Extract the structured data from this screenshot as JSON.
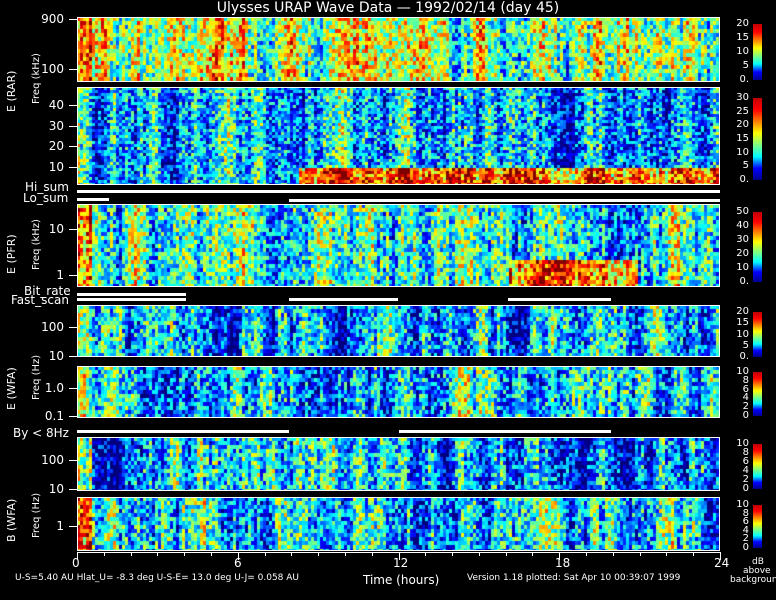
{
  "title": "Ulysses URAP Wave Data — 1992/02/14  (day 45)",
  "chart_data": {
    "type": "heatmap",
    "title": "Ulysses URAP Wave Data — 1992/02/14  (day 45)",
    "xlabel": "Time (hours)",
    "xlim": [
      0,
      24
    ],
    "xticks": [
      "0",
      "6",
      "12",
      "18",
      "24"
    ],
    "colorscale": "jet",
    "colorbar_label": [
      "dB",
      "above",
      "background"
    ],
    "panels": [
      {
        "group": "E (RAR)",
        "ylabel": "Freq (kHz)",
        "yscale": "log",
        "yticks": [
          "900",
          "100"
        ],
        "cbar_ticks": [
          "20",
          "15",
          "10",
          "5",
          "0."
        ]
      },
      {
        "group": "E (RAR)",
        "ylabel": "Freq (kHz)",
        "yscale": "linear",
        "yticks": [
          "40",
          "30",
          "20",
          "10"
        ],
        "cbar_ticks": [
          "30",
          "25",
          "20",
          "15",
          "10",
          "5",
          "0."
        ]
      },
      {
        "group": "E (PFR)",
        "ylabel": "Freq (kHz)",
        "yscale": "log",
        "yticks": [
          "10",
          "1"
        ],
        "cbar_ticks": [
          "50",
          "40",
          "30",
          "20",
          "10",
          "0."
        ]
      },
      {
        "group": "E (WFA)",
        "ylabel": "Freq (Hz)",
        "yscale": "log",
        "yticks": [
          "100",
          "10"
        ],
        "cbar_ticks": [
          "20",
          "15",
          "10",
          "5",
          "0."
        ]
      },
      {
        "group": "E (WFA)",
        "ylabel": "Freq (Hz)",
        "yscale": "log",
        "yticks": [
          "1.0",
          "0.1"
        ],
        "cbar_ticks": [
          "10",
          "8",
          "6",
          "4",
          "2",
          "0"
        ]
      },
      {
        "group": "B (WFA)",
        "ylabel": "Freq (Hz)",
        "yscale": "log",
        "yticks": [
          "100",
          "10"
        ],
        "cbar_ticks": [
          "10",
          "8",
          "6",
          "4",
          "2",
          "0"
        ]
      },
      {
        "group": "B (WFA)",
        "ylabel": "Freq (Hz)",
        "yscale": "log",
        "yticks": [
          "1"
        ],
        "cbar_ticks": [
          "10",
          "8",
          "6",
          "4",
          "2",
          "0"
        ]
      }
    ],
    "mode_bars": [
      {
        "labels": [
          "Hi_sum",
          "Lo_sum"
        ]
      },
      {
        "labels": [
          "Bit_rate",
          "Fast_scan"
        ]
      },
      {
        "labels": [
          "By < 8Hz"
        ]
      }
    ]
  },
  "footer": {
    "orbit": "U-S=5.40 AU  Hlat_U= -8.3 deg  U-S-E= 13.0 deg  U-J= 0.058 AU",
    "version": "Version 1.18 plotted: Sat Apr 10 00:39:07 1999"
  }
}
